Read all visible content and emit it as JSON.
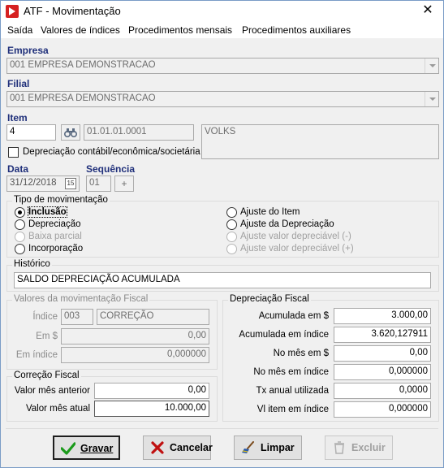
{
  "window": {
    "title": "ATF - Movimentação",
    "close_glyph": "✕"
  },
  "menu": [
    "Saída",
    "Valores de índices",
    "Procedimentos mensais",
    "Procedimentos auxiliares"
  ],
  "empresa": {
    "label": "Empresa",
    "value": "001 EMPRESA DEMONSTRACAO"
  },
  "filial": {
    "label": "Filial",
    "value": "001 EMPRESA DEMONSTRACAO"
  },
  "item": {
    "label": "Item",
    "number": "4",
    "code": "01.01.01.0001",
    "description": "VOLKS"
  },
  "depreciacao_check": {
    "label": "Depreciação contábil/econômica/societária"
  },
  "data": {
    "label": "Data",
    "value": "31/12/2018",
    "calendar_label": "15"
  },
  "sequencia": {
    "label": "Sequência",
    "value": "01",
    "plus_glyph": "+"
  },
  "tipo_movimentacao": {
    "title": "Tipo de movimentação",
    "left": [
      "Inclusão",
      "Depreciação",
      "Baixa parcial",
      "Incorporação"
    ],
    "right": [
      "Ajuste do Item",
      "Ajuste da Depreciação",
      "Ajuste valor depreciável (-)",
      "Ajuste valor depreciável (+)"
    ]
  },
  "historico": {
    "title": "Histórico",
    "value": "SALDO DEPRECIAÇÃO ACUMULADA"
  },
  "valores_mov_fiscal": {
    "title": "Valores da movimentação Fiscal",
    "indice_label": "Índice",
    "indice_code": "003",
    "indice_name": "CORREÇÃO",
    "em_rs_label": "Em $",
    "em_rs_value": "0,00",
    "em_indice_label": "Em índice",
    "em_indice_value": "0,000000"
  },
  "correcao_fiscal": {
    "title": "Correção Fiscal",
    "anterior_label": "Valor mês anterior",
    "anterior_value": "0,00",
    "atual_label": "Valor mês atual",
    "atual_value": "10.000,00"
  },
  "depreciacao_fiscal": {
    "title": "Depreciação Fiscal",
    "rows": [
      {
        "label": "Acumulada em $",
        "value": "3.000,00"
      },
      {
        "label": "Acumulada em índice",
        "value": "3.620,127911"
      },
      {
        "label": "No mês em $",
        "value": "0,00"
      },
      {
        "label": "No mês em índice",
        "value": "0,000000"
      },
      {
        "label": "Tx anual utilizada",
        "value": "0,0000"
      },
      {
        "label": "Vl item em índice",
        "value": "0,000000"
      }
    ]
  },
  "buttons": {
    "gravar": "Gravar",
    "cancelar": "Cancelar",
    "limpar": "Limpar",
    "excluir": "Excluir"
  },
  "icons": [
    "app-icon",
    "close-icon",
    "binoculars-icon",
    "calendar-icon",
    "plus-icon",
    "check-icon",
    "x-icon",
    "broom-icon",
    "recycle-icon"
  ],
  "colors": {
    "label_blue": "#1f2f7a",
    "gravar_green": "#1a9a1a",
    "cancel_red": "#c01010"
  }
}
